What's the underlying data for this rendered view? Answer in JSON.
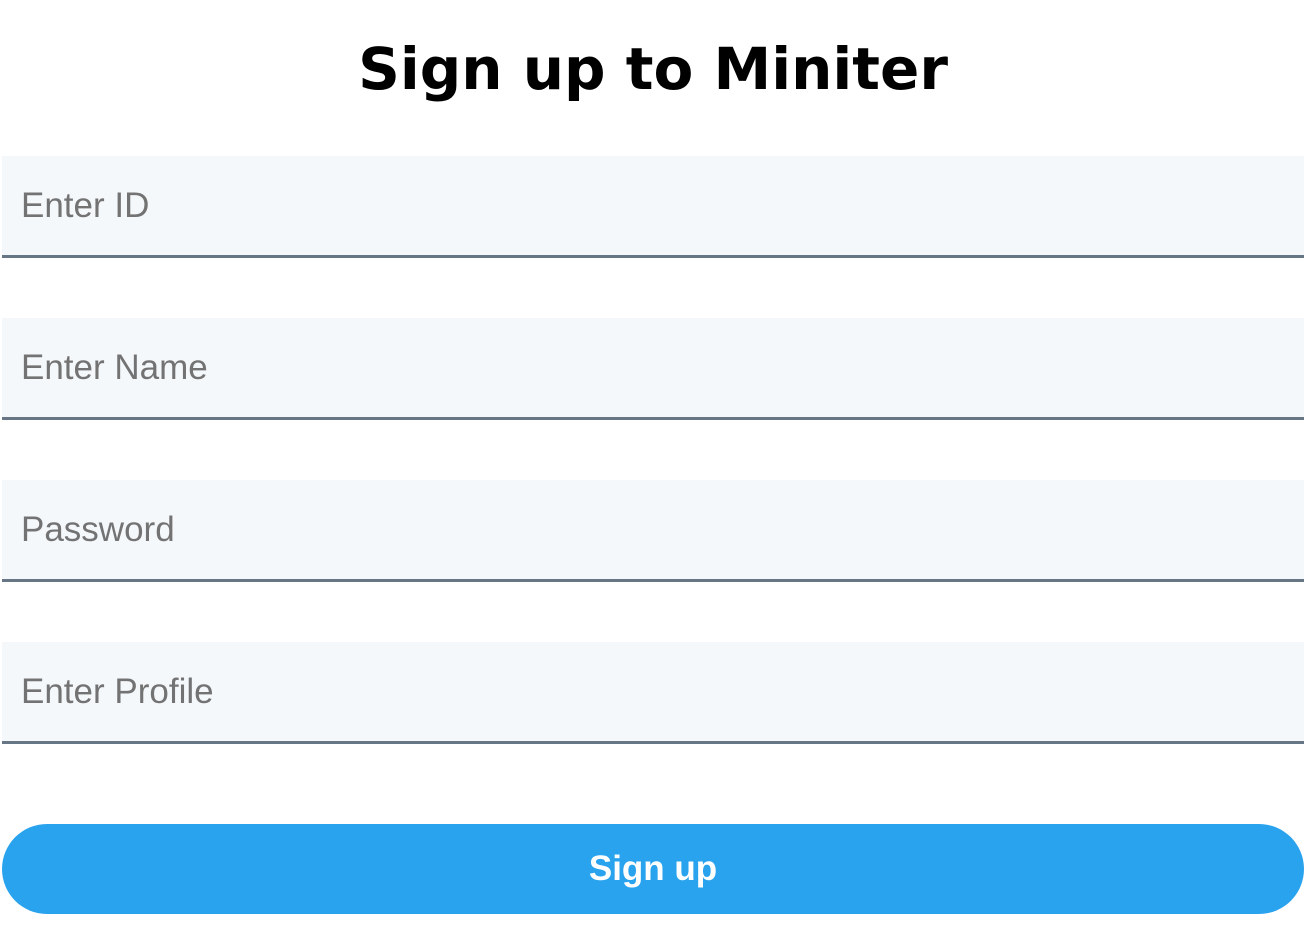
{
  "page": {
    "title": "Sign up to Miniter"
  },
  "form": {
    "fields": [
      {
        "placeholder": "Enter ID",
        "type": "text",
        "value": ""
      },
      {
        "placeholder": "Enter Name",
        "type": "text",
        "value": ""
      },
      {
        "placeholder": "Password",
        "type": "password",
        "value": ""
      },
      {
        "placeholder": "Enter Profile",
        "type": "text",
        "value": ""
      }
    ],
    "submit_label": "Sign up"
  },
  "colors": {
    "field_background": "#f4f8fb",
    "field_underline": "#667685",
    "placeholder_text": "#737373",
    "button_background": "#2aa3ef",
    "button_text": "#ffffff",
    "title_text": "#000000"
  }
}
